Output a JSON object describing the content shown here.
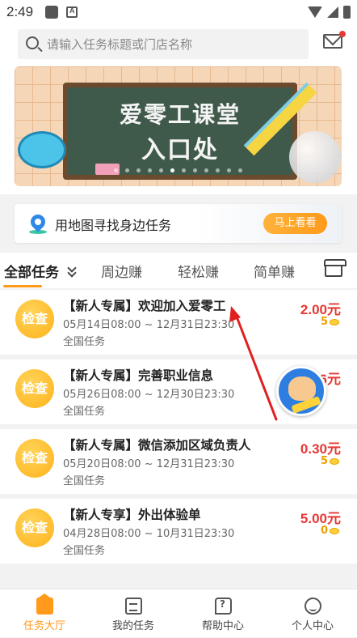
{
  "status_bar": {
    "time": "2:49"
  },
  "search": {
    "placeholder": "请输入任务标题或门店名称"
  },
  "banner": {
    "line1": "爱零工课堂",
    "line2": "入口处",
    "dot_count": 12,
    "active_dot": 5
  },
  "map_card": {
    "text": "用地图寻找身边任务",
    "button": "马上看看"
  },
  "tabs": [
    {
      "label": "全部任务"
    },
    {
      "label": "周边赚"
    },
    {
      "label": "轻松赚"
    },
    {
      "label": "简单赚"
    }
  ],
  "tasks": [
    {
      "badge": "检查",
      "title": "【新人专属】欢迎加入爱零工",
      "date": "05月14日08:00 ~ 12月31日23:30",
      "scope": "全国任务",
      "price": "2.00元",
      "coins": "5"
    },
    {
      "badge": "检查",
      "title": "【新人专属】完善职业信息",
      "date": "05月26日08:00 ~ 12月30日23:30",
      "scope": "全国任务",
      "price": "6元",
      "coins": ""
    },
    {
      "badge": "检查",
      "title": "【新人专属】微信添加区域负责人",
      "date": "05月20日08:00 ~ 12月31日23:30",
      "scope": "全国任务",
      "price": "0.30元",
      "coins": "5"
    },
    {
      "badge": "检查",
      "title": "【新人专享】外出体验单",
      "date": "04月28日08:00 ~ 10月31日23:30",
      "scope": "全国任务",
      "price": "5.00元",
      "coins": "0"
    }
  ],
  "bottom_nav": [
    {
      "label": "任务大厅"
    },
    {
      "label": "我的任务"
    },
    {
      "label": "帮助中心"
    },
    {
      "label": "个人中心"
    }
  ],
  "colors": {
    "accent": "#ff9a1a",
    "price_red": "#e53935",
    "annotation_arrow": "#e02020"
  }
}
